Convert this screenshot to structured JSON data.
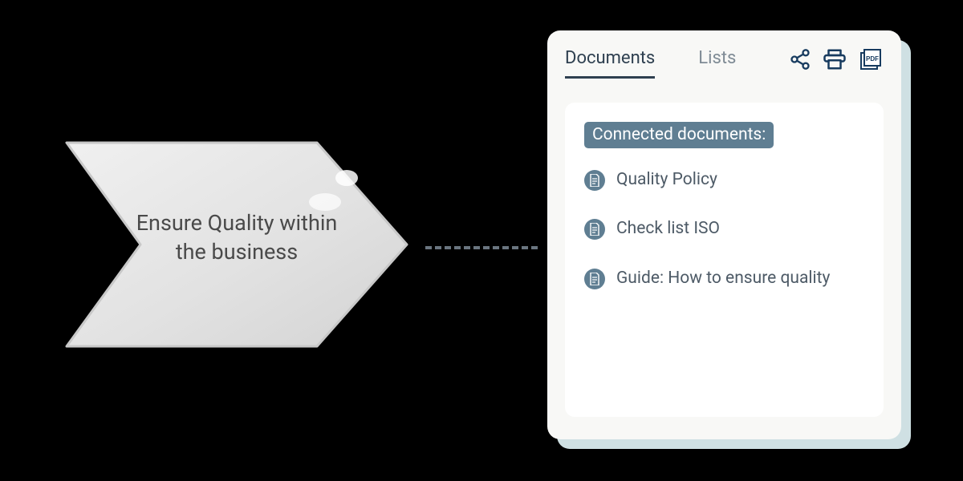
{
  "arrow": {
    "label": "Ensure Quality within the business"
  },
  "panel": {
    "tabs": [
      {
        "label": "Documents",
        "active": true
      },
      {
        "label": "Lists",
        "active": false
      }
    ],
    "icons": [
      "share-icon",
      "print-icon",
      "pdf-icon"
    ],
    "badge": "Connected documents:",
    "documents": [
      {
        "label": "Quality Policy"
      },
      {
        "label": "Check list ISO"
      },
      {
        "label": "Guide: How to ensure quality"
      }
    ]
  },
  "colors": {
    "accent": "#5f7e92",
    "tabActive": "#2f4050",
    "iconHeader": "#173b5f"
  }
}
